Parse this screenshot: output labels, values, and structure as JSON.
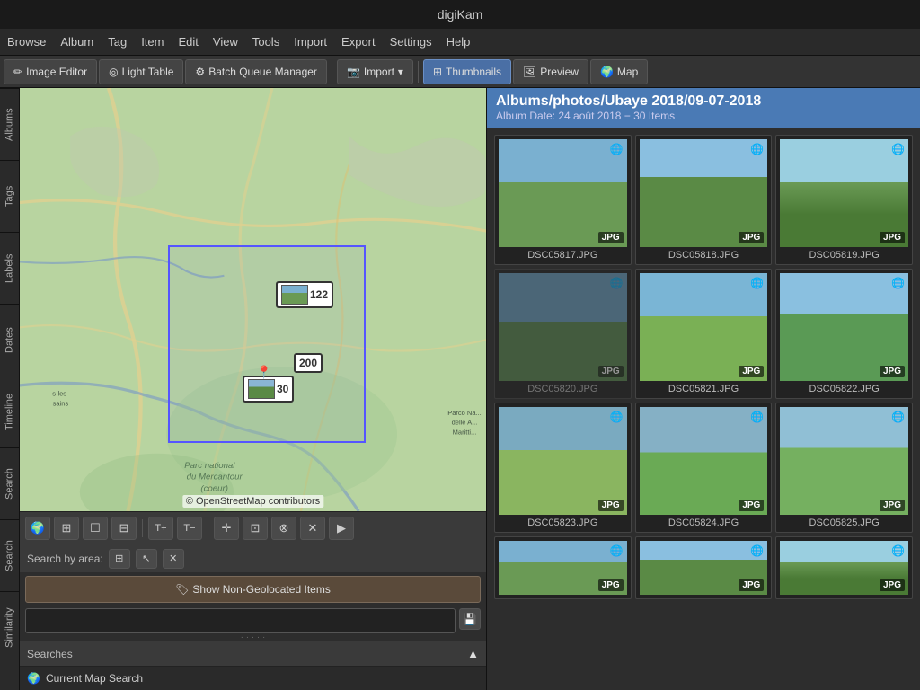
{
  "app": {
    "title": "digiKam"
  },
  "menu": {
    "items": [
      "Browse",
      "Album",
      "Tag",
      "Item",
      "Edit",
      "View",
      "Tools",
      "Import",
      "Export",
      "Settings",
      "Help"
    ]
  },
  "toolbar": {
    "image_editor": "Image Editor",
    "light_table": "Light Table",
    "batch_queue": "Batch Queue Manager",
    "import": "Import",
    "thumbnails": "Thumbnails",
    "preview": "Preview",
    "map": "Map"
  },
  "sidebar": {
    "tabs": [
      "Albums",
      "Tags",
      "Labels",
      "Dates",
      "Timeline",
      "Search",
      "Search",
      "Similarity"
    ]
  },
  "map": {
    "copyright": "© OpenStreetMap contributors",
    "cluster_122": "122",
    "cluster_200": "200",
    "cluster_30": "30"
  },
  "map_toolbar": {
    "tools": [
      "🌍",
      "⊞",
      "☐",
      "⊟",
      "T+",
      "T−",
      "✛",
      "⊡",
      "⊗",
      "✕",
      "▶"
    ]
  },
  "search_area": {
    "label": "Search by area:",
    "buttons": [
      "⊞",
      "↖",
      "✕"
    ]
  },
  "non_geo_btn": {
    "icon": "🏷",
    "label": "Show Non-Geolocated Items"
  },
  "searches": {
    "header": "Searches",
    "collapse_icon": "▲",
    "items": [
      {
        "icon": "🌍",
        "label": "Current Map Search"
      }
    ]
  },
  "album": {
    "title": "Albums/photos/Ubaye 2018/09-07-2018",
    "subtitle": "Album Date: 24 août 2018 − 30 Items"
  },
  "thumbnails": {
    "items": [
      {
        "name": "DSC05817.JPG",
        "color": "t1"
      },
      {
        "name": "DSC05818.JPG",
        "color": "t2"
      },
      {
        "name": "DSC05819.JPG",
        "color": "t3"
      },
      {
        "name": "DSC05820.JPG",
        "color": "t4"
      },
      {
        "name": "DSC05821.JPG",
        "color": "t5"
      },
      {
        "name": "DSC05822.JPG",
        "color": "t6"
      },
      {
        "name": "DSC05823.JPG",
        "color": "t7"
      },
      {
        "name": "DSC05824.JPG",
        "color": "t8"
      },
      {
        "name": "DSC05825.JPG",
        "color": "t9"
      }
    ]
  }
}
